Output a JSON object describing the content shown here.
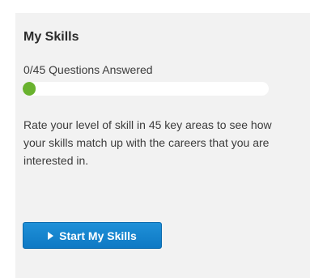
{
  "skills": {
    "title": "My Skills",
    "progress_text": "0/45 Questions Answered",
    "progress_fraction": 0.05,
    "description": "Rate your level of skill in 45 key areas to see how your skills match up with the careers that you are interested in.",
    "button_label": "Start My Skills",
    "button_icon": "play-icon"
  },
  "colors": {
    "panel_bg": "#f2f2f2",
    "progress_fill": "#69b22e",
    "button_bg": "#1585cf"
  }
}
